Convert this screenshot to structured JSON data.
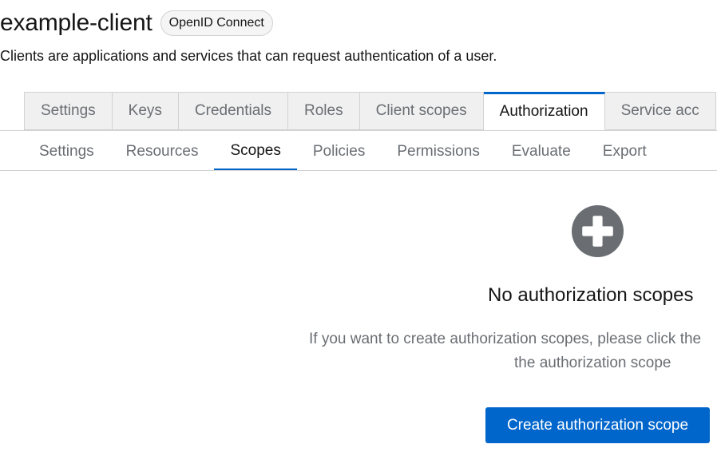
{
  "header": {
    "title": "example-client",
    "protocol_badge": "OpenID Connect",
    "subtitle": "Clients are applications and services that can request authentication of a user."
  },
  "main_tabs": [
    {
      "label": "Settings"
    },
    {
      "label": "Keys"
    },
    {
      "label": "Credentials"
    },
    {
      "label": "Roles"
    },
    {
      "label": "Client scopes"
    },
    {
      "label": "Authorization",
      "active": true
    },
    {
      "label": "Service acc"
    }
  ],
  "sub_tabs": [
    {
      "label": "Settings"
    },
    {
      "label": "Resources"
    },
    {
      "label": "Scopes",
      "active": true
    },
    {
      "label": "Policies"
    },
    {
      "label": "Permissions"
    },
    {
      "label": "Evaluate"
    },
    {
      "label": "Export"
    }
  ],
  "empty_state": {
    "icon": "plus-circle-icon",
    "title": "No authorization scopes",
    "body_line1": "If you want to create authorization scopes, please click the",
    "body_line2": "the authorization scope",
    "button_label": "Create authorization scope"
  },
  "colors": {
    "accent": "#0066cc",
    "icon_gray": "#6a6e73"
  }
}
